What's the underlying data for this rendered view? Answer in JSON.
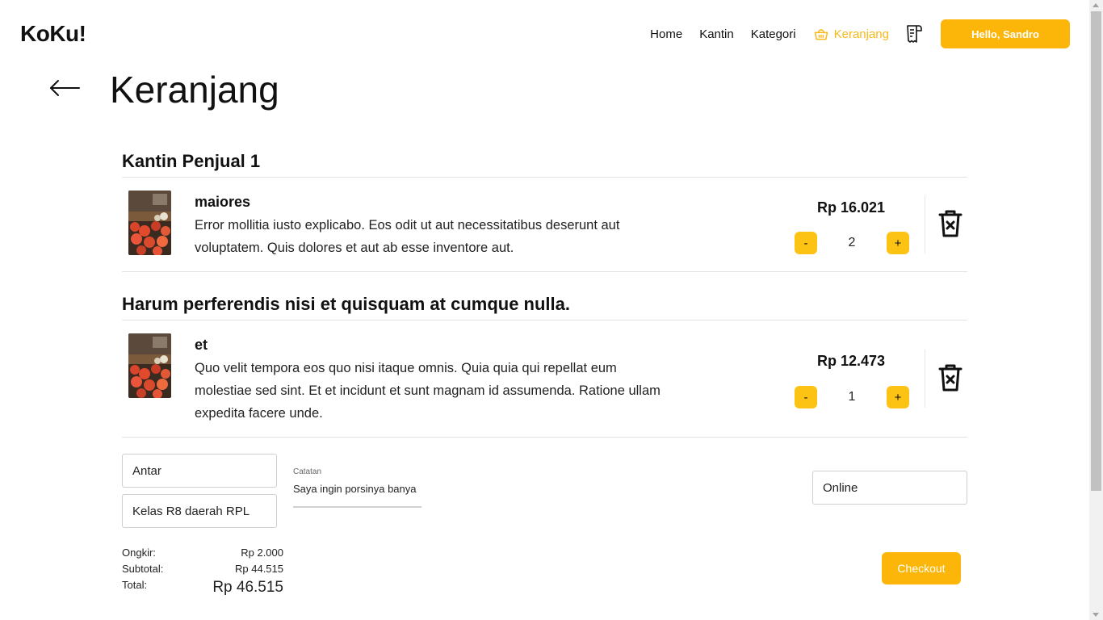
{
  "brand": "KoKu!",
  "nav": {
    "home": "Home",
    "kantin": "Kantin",
    "kategori": "Kategori",
    "keranjang": "Keranjang",
    "greeting": "Hello, Sandro"
  },
  "page_title": "Keranjang",
  "shops": [
    {
      "name": "Kantin Penjual 1",
      "items": [
        {
          "name": "maiores",
          "description": "Error mollitia iusto explicabo. Eos odit ut aut necessitatibus deserunt aut voluptatem. Quis dolores et aut ab esse inventore aut.",
          "price": "Rp 16.021",
          "quantity": "2",
          "minus": "-",
          "plus": "+"
        }
      ]
    },
    {
      "name": "Harum perferendis nisi et quisquam at cumque nulla.",
      "items": [
        {
          "name": "et",
          "description": "Quo velit tempora eos quo nisi itaque omnis. Quia quia qui repellat eum molestiae sed sint. Et et incidunt et sunt magnam id assumenda. Ratione ullam expedita facere unde.",
          "price": "Rp 12.473",
          "quantity": "1",
          "minus": "-",
          "plus": "+"
        }
      ]
    }
  ],
  "form": {
    "delivery_method": "Antar",
    "location": "Kelas R8 daerah RPL",
    "note_label": "Catatan",
    "note_value": "Saya ingin porsinya banya",
    "payment": "Online"
  },
  "summary": {
    "ongkir_label": "Ongkir:",
    "ongkir_value": "Rp 2.000",
    "subtotal_label": "Subtotal:",
    "subtotal_value": "Rp 44.515",
    "total_label": "Total:",
    "total_value": "Rp 46.515"
  },
  "checkout_label": "Checkout",
  "colors": {
    "accent": "#fcb60a",
    "qty_button": "#fcc314",
    "active_nav": "#f8b81a"
  },
  "icons": [
    "back-arrow-icon",
    "basket-icon",
    "receipt-icon",
    "trash-icon"
  ]
}
